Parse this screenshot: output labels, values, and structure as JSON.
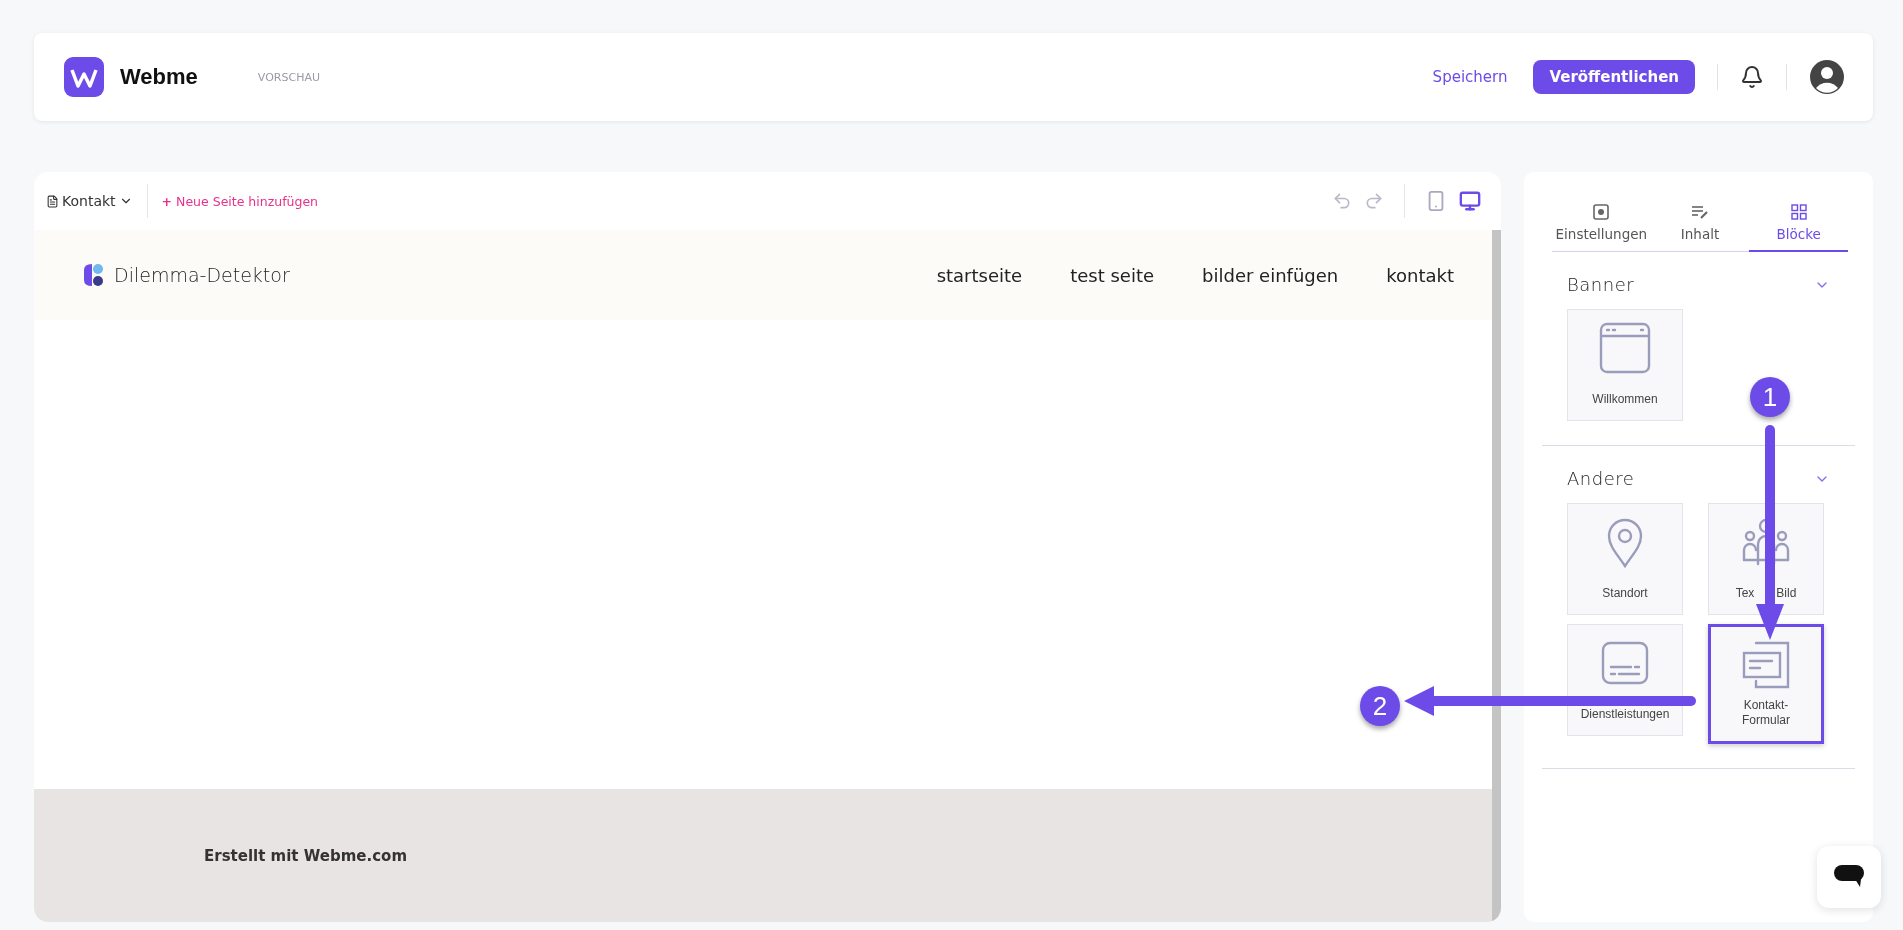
{
  "header": {
    "brand": "Webme",
    "mode": "VORSCHAU",
    "save": "Speichern",
    "publish": "Veröffentlichen"
  },
  "editor": {
    "page": "Kontakt",
    "add_icon": "+",
    "add_page": "Neue Seite hinzufügen",
    "devices": [
      {
        "kind": "mobile",
        "selected": false
      },
      {
        "kind": "desktop",
        "selected": true
      }
    ]
  },
  "preview": {
    "site_name": "Dilemma-Detektor",
    "nav": [
      "startseite",
      "test seite",
      "bilder einfügen",
      "kontakt"
    ],
    "footer": "Erstellt mit Webme.com"
  },
  "panel": {
    "tabs": [
      {
        "kind": "settings",
        "label": "Einstellungen",
        "selected": false
      },
      {
        "kind": "content",
        "label": "Inhalt",
        "selected": false
      },
      {
        "kind": "blocks",
        "label": "Blöcke",
        "selected": true
      }
    ],
    "sections": [
      {
        "title": "Banner",
        "blocks": [
          {
            "kind": "window",
            "label": "Willkommen",
            "highlighted": false
          }
        ]
      },
      {
        "title": "Andere",
        "blocks": [
          {
            "kind": "pin",
            "label": "Standort",
            "highlighted": false
          },
          {
            "kind": "people",
            "label_parts": [
              "Tex",
              "Bild"
            ],
            "highlighted": false
          },
          {
            "kind": "card",
            "label": "Dienstleistungen",
            "highlighted": false
          },
          {
            "kind": "form",
            "label": "Kontakt-Formular",
            "highlighted": true
          }
        ]
      }
    ]
  },
  "annotations": [
    "1",
    "2"
  ]
}
